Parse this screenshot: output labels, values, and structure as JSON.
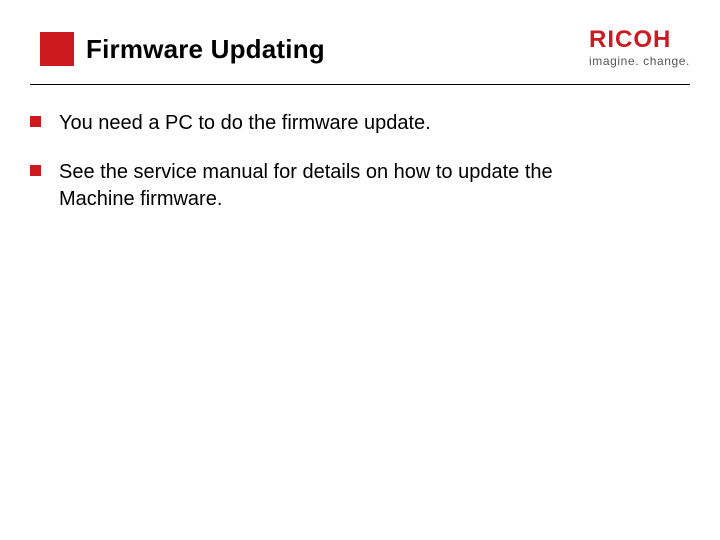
{
  "header": {
    "title": "Firmware Updating",
    "logo_name": "RICOH",
    "logo_tagline": "imagine. change."
  },
  "bullets": [
    {
      "text": "You need a PC to do the firmware update."
    },
    {
      "text": "See the service manual for details on how to update the Machine firmware."
    }
  ],
  "colors": {
    "accent": "#cc1a20",
    "text": "#000000",
    "tagline": "#555555"
  }
}
